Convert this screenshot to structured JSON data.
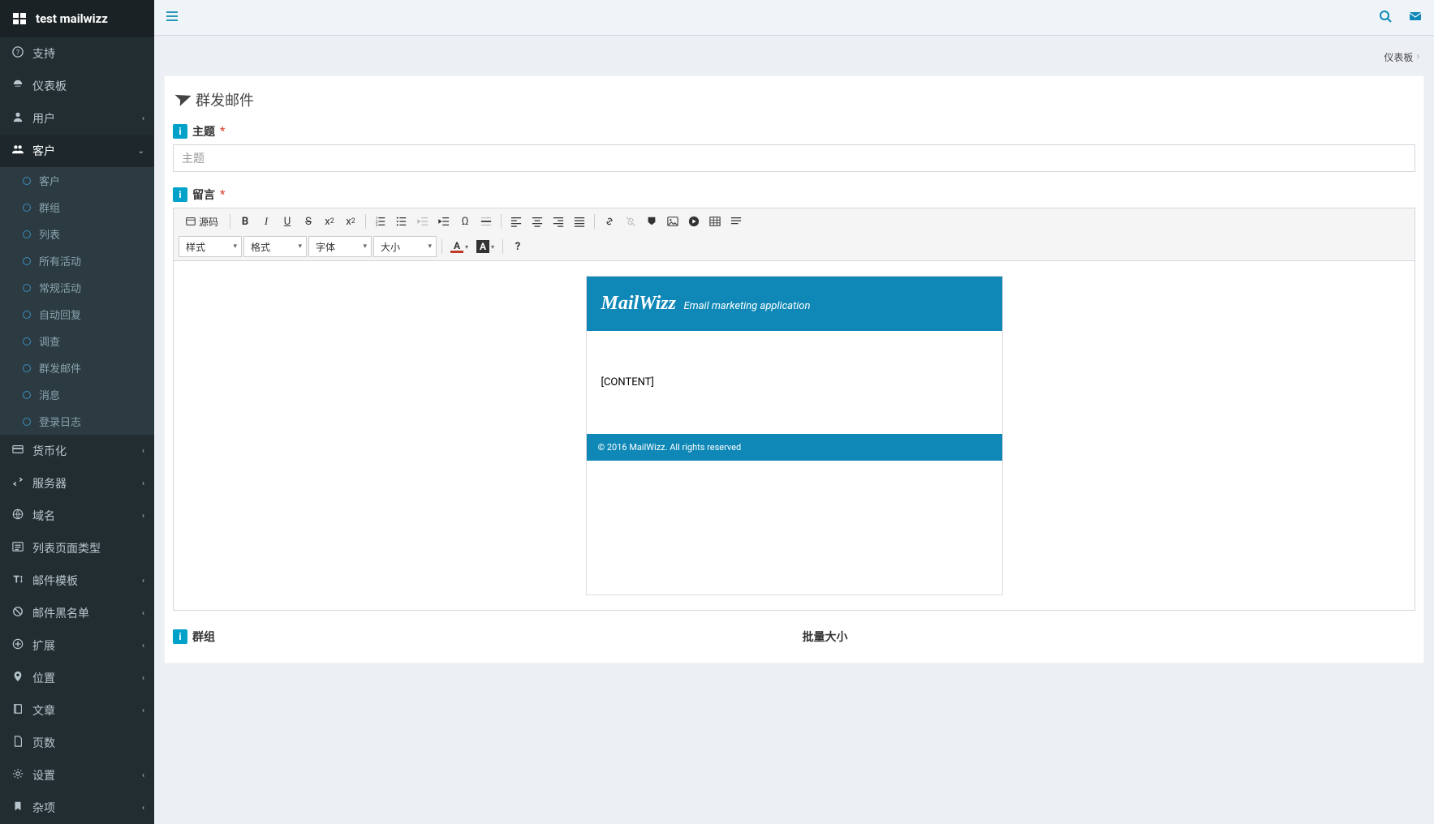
{
  "app": {
    "title": "test mailwizz"
  },
  "topbar": {
    "breadcrumb": "仪表板"
  },
  "sidebar": {
    "items": [
      {
        "icon": "support",
        "label": "支持",
        "expandable": false
      },
      {
        "icon": "dashboard",
        "label": "仪表板",
        "expandable": false
      },
      {
        "icon": "user",
        "label": "用户",
        "expandable": true
      },
      {
        "icon": "customers",
        "label": "客户",
        "expandable": true,
        "active": true,
        "children": [
          {
            "label": "客户"
          },
          {
            "label": "群组"
          },
          {
            "label": "列表"
          },
          {
            "label": "所有活动"
          },
          {
            "label": "常规活动"
          },
          {
            "label": "自动回复"
          },
          {
            "label": "调查"
          },
          {
            "label": "群发邮件"
          },
          {
            "label": "消息"
          },
          {
            "label": "登录日志"
          }
        ]
      },
      {
        "icon": "money",
        "label": "货币化",
        "expandable": true
      },
      {
        "icon": "server",
        "label": "服务器",
        "expandable": true
      },
      {
        "icon": "globe",
        "label": "域名",
        "expandable": true
      },
      {
        "icon": "listpage",
        "label": "列表页面类型",
        "expandable": false
      },
      {
        "icon": "template",
        "label": "邮件模板",
        "expandable": true
      },
      {
        "icon": "blacklist",
        "label": "邮件黑名单",
        "expandable": true
      },
      {
        "icon": "extend",
        "label": "扩展",
        "expandable": true
      },
      {
        "icon": "location",
        "label": "位置",
        "expandable": true
      },
      {
        "icon": "article",
        "label": "文章",
        "expandable": true
      },
      {
        "icon": "pages",
        "label": "页数",
        "expandable": false
      },
      {
        "icon": "settings",
        "label": "设置",
        "expandable": true
      },
      {
        "icon": "misc",
        "label": "杂项",
        "expandable": true
      }
    ]
  },
  "page": {
    "title": "群发邮件",
    "subject_label": "主题",
    "subject_placeholder": "主题",
    "message_label": "留言",
    "group_label": "群组",
    "batch_label": "批量大小"
  },
  "editor": {
    "source_label": "源码",
    "styles": "样式",
    "format": "格式",
    "font": "字体",
    "size": "大小",
    "email": {
      "brand": "MailWizz",
      "tagline": "Email marketing application",
      "content": "[CONTENT]",
      "footer": "© 2016 MailWizz. All rights reserved"
    }
  }
}
